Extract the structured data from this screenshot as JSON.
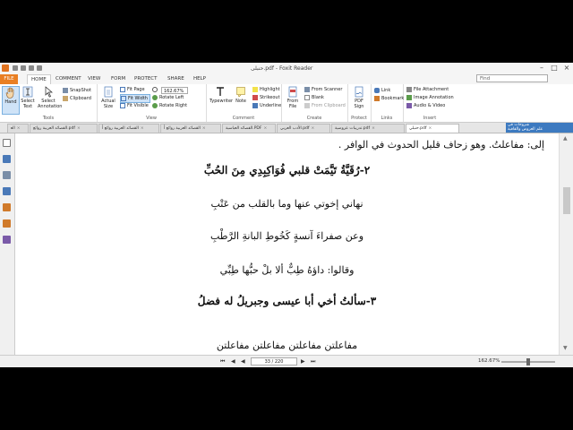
{
  "window": {
    "title": "حنبلی.pdf - Foxit Reader",
    "minimize": "–",
    "maximize": "□",
    "close": "×"
  },
  "menu": {
    "file": "FILE",
    "home": "HOME",
    "comment": "COMMENT",
    "view": "VIEW",
    "form": "FORM",
    "protect": "PROTECT",
    "share": "SHARE",
    "help": "HELP"
  },
  "find": {
    "placeholder": "Find"
  },
  "ribbon": {
    "tools": {
      "label": "Tools",
      "hand": "Hand",
      "select_text": "Select Text",
      "select_annotation": "Select Annotation",
      "snapshot": "SnapShot",
      "clipboard": "Clipboard"
    },
    "view": {
      "label": "View",
      "actual_size": "Actual Size",
      "fit_page": "Fit Page",
      "fit_width": "Fit Width",
      "fit_visible": "Fit Visible",
      "zoom_value": "162.67%",
      "rotate_left": "Rotate Left",
      "rotate_right": "Rotate Right"
    },
    "comment": {
      "label": "Comment",
      "typewriter": "Typewriter",
      "note": "Note",
      "highlight": "Highlight",
      "strikeout": "Strikeout",
      "underline": "Underline"
    },
    "create": {
      "label": "Create",
      "from_file": "From File",
      "from_scanner": "From Scanner",
      "blank": "Blank",
      "from_clipboard": "From Clipboard"
    },
    "protect": {
      "label": "Protect",
      "pdf_sign": "PDF Sign"
    },
    "links": {
      "label": "Links",
      "link": "Link",
      "bookmark": "Bookmark"
    },
    "insert": {
      "label": "Insert",
      "file_attachment": "File Attachment",
      "image_annotation": "Image Annotation",
      "audio_video": "Audio & Video"
    }
  },
  "tabs": [
    {
      "label": "ﺍﻟﻌ",
      "active": false
    },
    {
      "label": "ﺍﻟﻘﺼﺎﺋﺪ ﺍﻟﻌﺮﺑﻴﺔ ﺭﻭﺍﺋﻊ.pdf",
      "active": false
    },
    {
      "label": "ﺍﻟﻘﺼﺎﺋﺪ ﺍﻟﻌﺮﺑﻴﺔ ﺭﻭﺍﺋﻊ ﺃ",
      "active": false
    },
    {
      "label": "ﺍﻟﻘﺼﺎﺋﺪ ﺍﻟﻌﺮﺑﻴﺔ ﺭﻭﺍﺋﻊ ﺃ",
      "active": false
    },
    {
      "label": "ﺍﻟﻘﺼﺎﺋﺪ ﺍﻟﻌﺒﺎﺳﻴﺔ.PDF",
      "active": false
    },
    {
      "label": "ﺍﻷﺩﺏ ﺍﻟﻌﺮﺑﻲ.pdf",
      "active": false
    },
    {
      "label": "ﺗﺪﺭﻳﺒﺎﺕ ﻋﺮﻭﺿﻴﺔ.pdf",
      "active": false
    },
    {
      "label": "ﺣﻨﺒﻠﻲ.pdf",
      "active": true
    }
  ],
  "tab_close": "×",
  "banner": {
    "line1": "ﺷﺮﻭﺣﺎﺕ ﻓﻲ",
    "line2": "ﻋﻠﻢ ﺍﻟﻌﺮﻭﺽ ﻭﺍﻟﻘﺎﻓﻴﺔ"
  },
  "document": {
    "lines": [
      "إلى: مفاعلتُ. وهو زحاف قليل الحدوث في الوافر .",
      "٢-رُقَيَّةُ تَيَّمَتْ قلبي   فُوَاكِبِدِي مِنَ الحُبِّ",
      "نهاني إخوتي عنها    وما بالقلب من عَتْبِ",
      "وعن صفراءَ آنسةٍ   كَخُوطِ البانةِ الرَّطْبِ",
      "وقالوا: داؤهُ طِبٌّ    ألا بلْ حبُّها طِبِّي",
      "٣-سألتُ أخي أبا عيسى   وجبريلُ له فضلُ",
      "مفاعلتن  مفاعلتن  مفاعلتن  مفاعلتن"
    ]
  },
  "status": {
    "first": "⏮",
    "prev": "◀",
    "next": "▶",
    "last": "⏭",
    "page": "33 / 220",
    "zoom": "162.67%",
    "zoom_level": 0.5
  }
}
